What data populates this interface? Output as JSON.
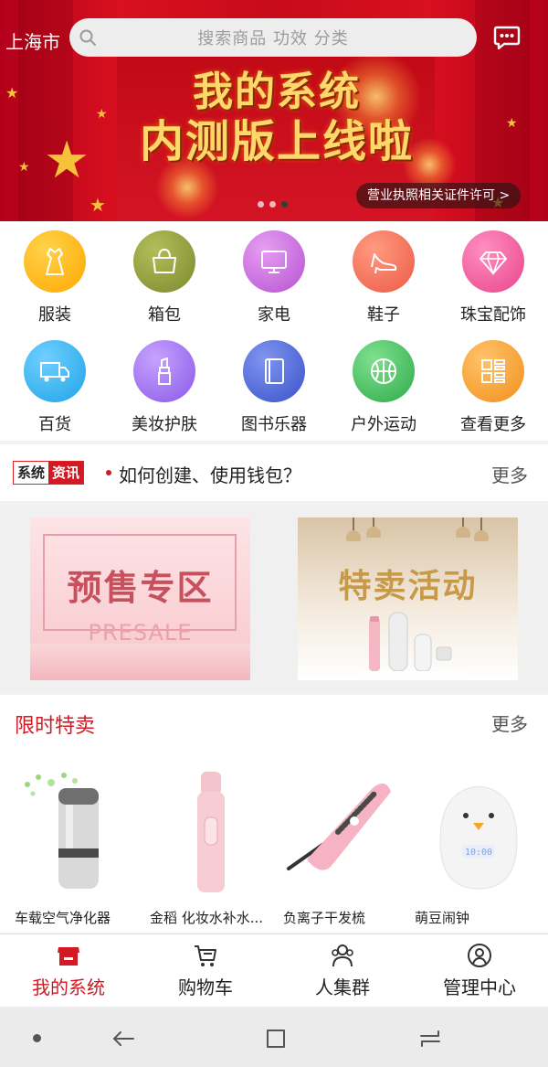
{
  "header": {
    "city": "上海市",
    "search_placeholder": "搜索商品 功效 分类"
  },
  "banner": {
    "title_line1": "我的系统",
    "title_line2": "内测版上线啦",
    "license_link": "营业执照相关证件许可 >",
    "slides": 3,
    "active_slide": 2
  },
  "categories": [
    {
      "label": "服装",
      "icon": "dress-icon",
      "color": "#ffb300"
    },
    {
      "label": "箱包",
      "icon": "handbag-icon",
      "color": "#8f9a3b"
    },
    {
      "label": "家电",
      "icon": "monitor-icon",
      "color": "#c86ad8"
    },
    {
      "label": "鞋子",
      "icon": "high-heel-icon",
      "color": "#f2705a"
    },
    {
      "label": "珠宝配饰",
      "icon": "diamond-icon",
      "color": "#f05a9a"
    },
    {
      "label": "百货",
      "icon": "truck-icon",
      "color": "#31b3ee"
    },
    {
      "label": "美妆护肤",
      "icon": "lipstick-icon",
      "color": "#9a6cf0"
    },
    {
      "label": "图书乐器",
      "icon": "book-icon",
      "color": "#4a62d8"
    },
    {
      "label": "户外运动",
      "icon": "basketball-icon",
      "color": "#3fbf5a"
    },
    {
      "label": "查看更多",
      "icon": "grid-icon",
      "color": "#f7a02a"
    }
  ],
  "news": {
    "logo_a": "系统",
    "logo_b": "资讯",
    "headline": "如何创建、使用钱包？",
    "more": "更多"
  },
  "promo": {
    "presale_title": "预售专区",
    "presale_sub": "PRESALE",
    "special_title": "特卖活动"
  },
  "flash_sale": {
    "title": "限时特卖",
    "more": "更多",
    "products": [
      {
        "name": "车载空气净化器"
      },
      {
        "name": "金稻 化妆水补水..."
      },
      {
        "name": "负离子干发梳"
      },
      {
        "name": "萌豆闹钟"
      }
    ]
  },
  "tabbar": {
    "tabs": [
      {
        "label": "我的系统",
        "icon": "store-icon",
        "active": true
      },
      {
        "label": "购物车",
        "icon": "cart-icon",
        "active": false
      },
      {
        "label": "人集群",
        "icon": "group-icon",
        "active": false
      },
      {
        "label": "管理中心",
        "icon": "user-icon",
        "active": false
      }
    ]
  },
  "colors": {
    "brand_red": "#d31a24",
    "banner_red": "#c80b1a"
  }
}
